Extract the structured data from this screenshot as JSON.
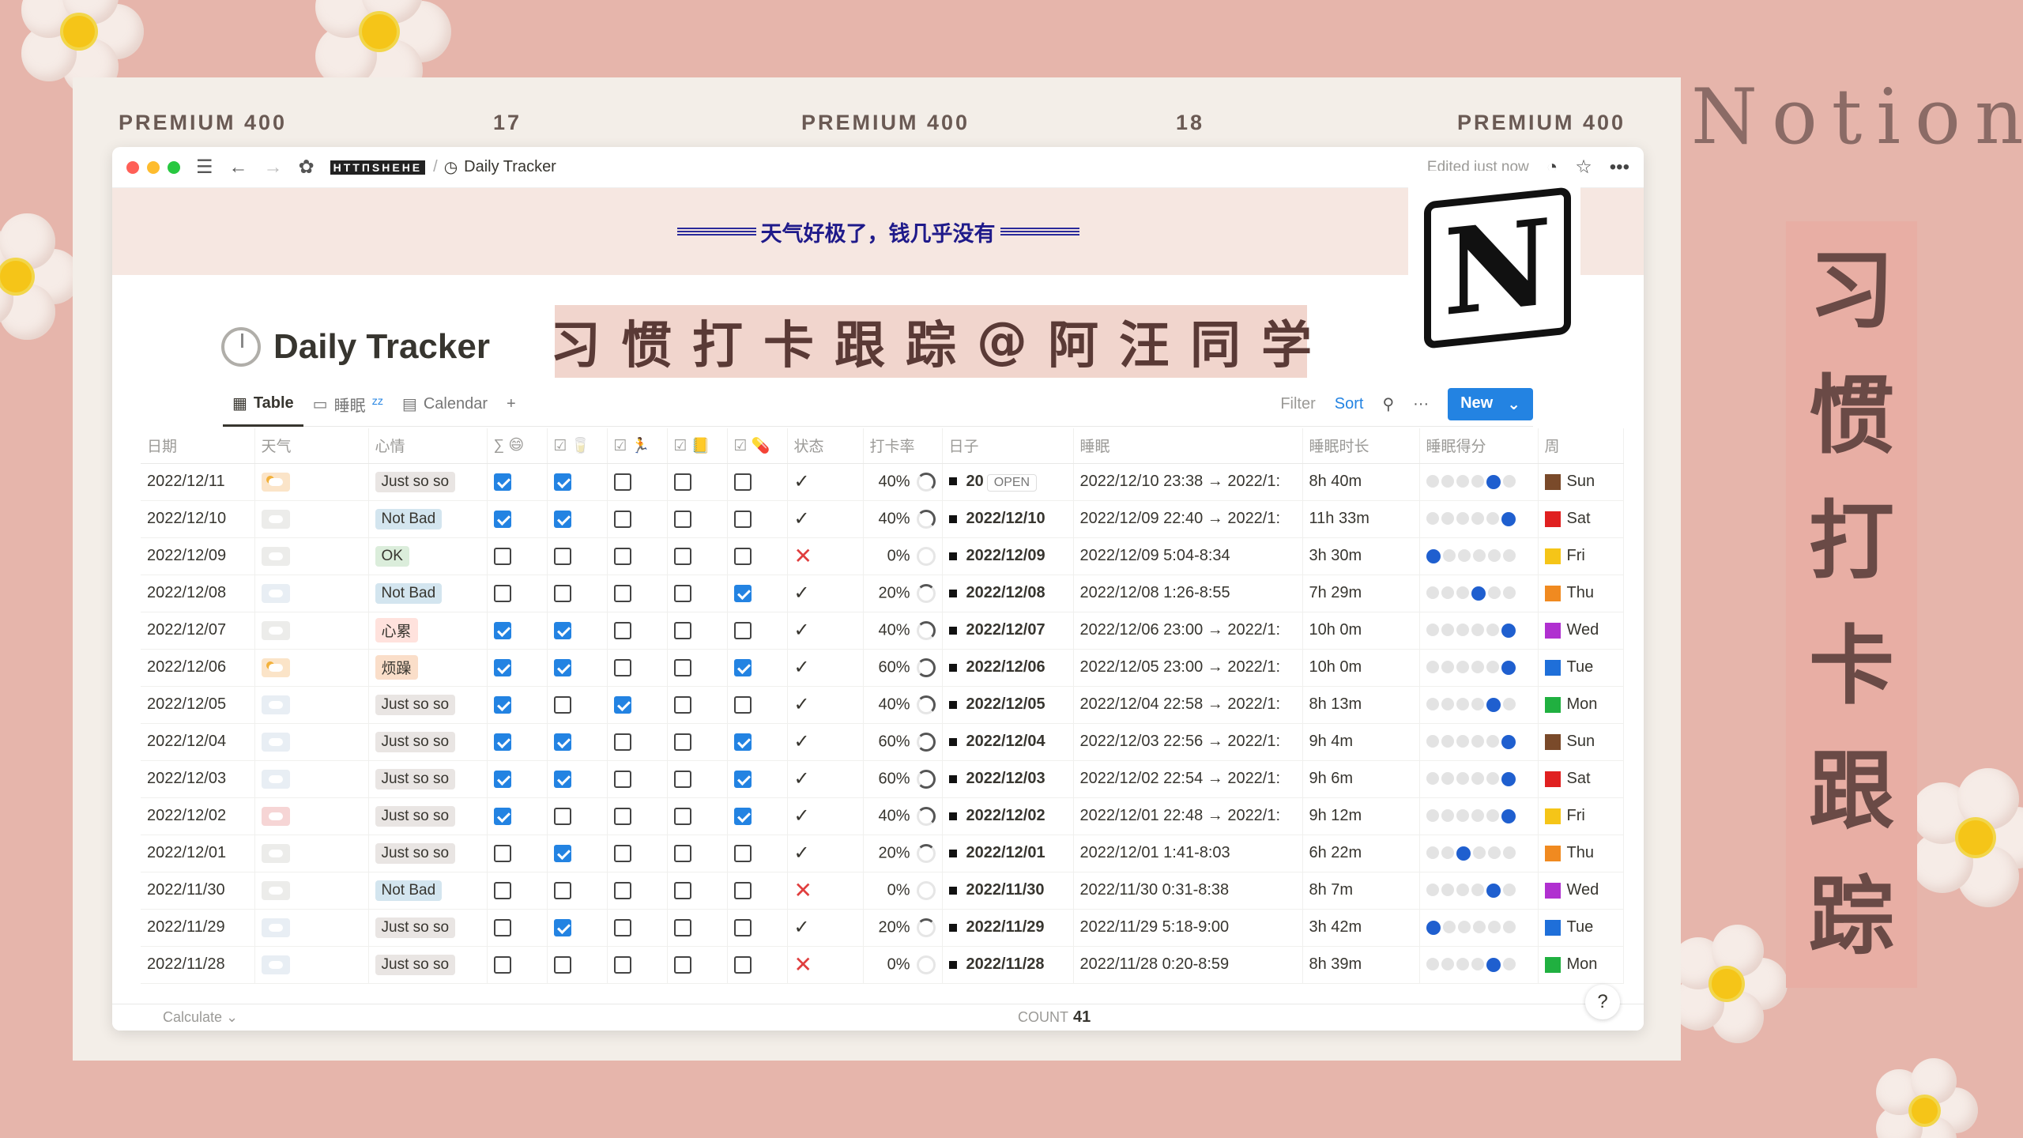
{
  "premium_labels": [
    "PREMIUM 400",
    "17",
    "PREMIUM 400",
    "18",
    "PREMIUM 400"
  ],
  "brand_word": "Notion",
  "vertical_title": [
    "习",
    "惯",
    "打",
    "卡",
    "跟",
    "踪"
  ],
  "titlebar": {
    "workspace": "НТТПЅНЕНЕ",
    "page": "Daily Tracker",
    "edited": "Edited just now"
  },
  "cover_text": "天气好极了，钱几乎没有",
  "page_title": "Daily Tracker",
  "banner_chars": [
    "习",
    "惯",
    "打",
    "卡",
    "跟",
    "踪",
    "@",
    "阿",
    "汪",
    "同",
    "学"
  ],
  "logo_letter": "N",
  "views": {
    "table": "Table",
    "sleep": "睡眠",
    "calendar": "Calendar",
    "add": "+"
  },
  "toolbar": {
    "filter": "Filter",
    "sort": "Sort",
    "more": "···",
    "new": "New"
  },
  "columns": [
    "日期",
    "天气",
    "心情",
    "∑ 😄",
    "☑ 🥛",
    "☑ 🏃",
    "☑ 📒",
    "☑ 💊",
    "状态",
    "打卡率",
    "日子",
    "睡眠",
    "睡眠时长",
    "睡眠得分",
    "周"
  ],
  "open_label": "OPEN",
  "rows": [
    {
      "date": "2022/12/11",
      "wx": "sun",
      "mood": "Just so so",
      "mc": "m-just",
      "c": [
        1,
        1,
        0,
        0,
        0
      ],
      "ok": 1,
      "rate": "40%",
      "day": "20",
      "sleep": "2022/12/10 23:38 → 2022/1:",
      "dur": "8h 40m",
      "score": 5,
      "wk": "Sun",
      "wc": "#7a4a2a"
    },
    {
      "date": "2022/12/10",
      "wx": "cloud",
      "mood": "Not Bad",
      "mc": "m-notbad",
      "c": [
        1,
        1,
        0,
        0,
        0
      ],
      "ok": 1,
      "rate": "40%",
      "day": "2022/12/10",
      "sleep": "2022/12/09 22:40 → 2022/1:",
      "dur": "11h 33m",
      "score": 6,
      "wk": "Sat",
      "wc": "#e02020"
    },
    {
      "date": "2022/12/09",
      "wx": "cloud",
      "mood": "OK",
      "mc": "m-ok",
      "c": [
        0,
        0,
        0,
        0,
        0
      ],
      "ok": 0,
      "rate": "0%",
      "day": "2022/12/09",
      "sleep": "2022/12/09 5:04-8:34",
      "dur": "3h 30m",
      "score": 1,
      "wk": "Fri",
      "wc": "#f5c518"
    },
    {
      "date": "2022/12/08",
      "wx": "rain",
      "mood": "Not Bad",
      "mc": "m-notbad",
      "c": [
        0,
        0,
        0,
        0,
        1
      ],
      "ok": 1,
      "rate": "20%",
      "day": "2022/12/08",
      "sleep": "2022/12/08 1:26-8:55",
      "dur": "7h 29m",
      "score": 4,
      "wk": "Thu",
      "wc": "#f08a20"
    },
    {
      "date": "2022/12/07",
      "wx": "cloud",
      "mood": "心累",
      "mc": "m-tired",
      "c": [
        1,
        1,
        0,
        0,
        0
      ],
      "ok": 1,
      "rate": "40%",
      "day": "2022/12/07",
      "sleep": "2022/12/06 23:00 → 2022/1:",
      "dur": "10h 0m",
      "score": 6,
      "wk": "Wed",
      "wc": "#b030d0"
    },
    {
      "date": "2022/12/06",
      "wx": "sun",
      "mood": "烦躁",
      "mc": "m-bored",
      "c": [
        1,
        1,
        0,
        0,
        1
      ],
      "ok": 1,
      "rate": "60%",
      "day": "2022/12/06",
      "sleep": "2022/12/05 23:00 → 2022/1:",
      "dur": "10h 0m",
      "score": 6,
      "wk": "Tue",
      "wc": "#1f6fd9"
    },
    {
      "date": "2022/12/05",
      "wx": "rain",
      "mood": "Just so so",
      "mc": "m-just",
      "c": [
        1,
        0,
        1,
        0,
        0
      ],
      "ok": 1,
      "rate": "40%",
      "day": "2022/12/05",
      "sleep": "2022/12/04 22:58 → 2022/1:",
      "dur": "8h 13m",
      "score": 5,
      "wk": "Mon",
      "wc": "#20b040"
    },
    {
      "date": "2022/12/04",
      "wx": "rain",
      "mood": "Just so so",
      "mc": "m-just",
      "c": [
        1,
        1,
        0,
        0,
        1
      ],
      "ok": 1,
      "rate": "60%",
      "day": "2022/12/04",
      "sleep": "2022/12/03 22:56 → 2022/1:",
      "dur": "9h 4m",
      "score": 6,
      "wk": "Sun",
      "wc": "#7a4a2a"
    },
    {
      "date": "2022/12/03",
      "wx": "rain",
      "mood": "Just so so",
      "mc": "m-just",
      "c": [
        1,
        1,
        0,
        0,
        1
      ],
      "ok": 1,
      "rate": "60%",
      "day": "2022/12/03",
      "sleep": "2022/12/02 22:54 → 2022/1:",
      "dur": "9h 6m",
      "score": 6,
      "wk": "Sat",
      "wc": "#e02020"
    },
    {
      "date": "2022/12/02",
      "wx": "pink",
      "mood": "Just so so",
      "mc": "m-just",
      "c": [
        1,
        0,
        0,
        0,
        1
      ],
      "ok": 1,
      "rate": "40%",
      "day": "2022/12/02",
      "sleep": "2022/12/01 22:48 → 2022/1:",
      "dur": "9h 12m",
      "score": 6,
      "wk": "Fri",
      "wc": "#f5c518"
    },
    {
      "date": "2022/12/01",
      "wx": "cloud",
      "mood": "Just so so",
      "mc": "m-just",
      "c": [
        0,
        1,
        0,
        0,
        0
      ],
      "ok": 1,
      "rate": "20%",
      "day": "2022/12/01",
      "sleep": "2022/12/01 1:41-8:03",
      "dur": "6h 22m",
      "score": 3,
      "wk": "Thu",
      "wc": "#f08a20"
    },
    {
      "date": "2022/11/30",
      "wx": "cloud",
      "mood": "Not Bad",
      "mc": "m-notbad",
      "c": [
        0,
        0,
        0,
        0,
        0
      ],
      "ok": 0,
      "rate": "0%",
      "day": "2022/11/30",
      "sleep": "2022/11/30 0:31-8:38",
      "dur": "8h 7m",
      "score": 5,
      "wk": "Wed",
      "wc": "#b030d0"
    },
    {
      "date": "2022/11/29",
      "wx": "rain",
      "mood": "Just so so",
      "mc": "m-just",
      "c": [
        0,
        1,
        0,
        0,
        0
      ],
      "ok": 1,
      "rate": "20%",
      "day": "2022/11/29",
      "sleep": "2022/11/29 5:18-9:00",
      "dur": "3h 42m",
      "score": 1,
      "wk": "Tue",
      "wc": "#1f6fd9"
    },
    {
      "date": "2022/11/28",
      "wx": "rain",
      "mood": "Just so so",
      "mc": "m-just",
      "c": [
        0,
        0,
        0,
        0,
        0
      ],
      "ok": 0,
      "rate": "0%",
      "day": "2022/11/28",
      "sleep": "2022/11/28 0:20-8:59",
      "dur": "8h 39m",
      "score": 5,
      "wk": "Mon",
      "wc": "#20b040"
    }
  ],
  "footer": {
    "calculate": "Calculate ⌄",
    "count_label": "COUNT",
    "count": "41"
  },
  "help": "?"
}
